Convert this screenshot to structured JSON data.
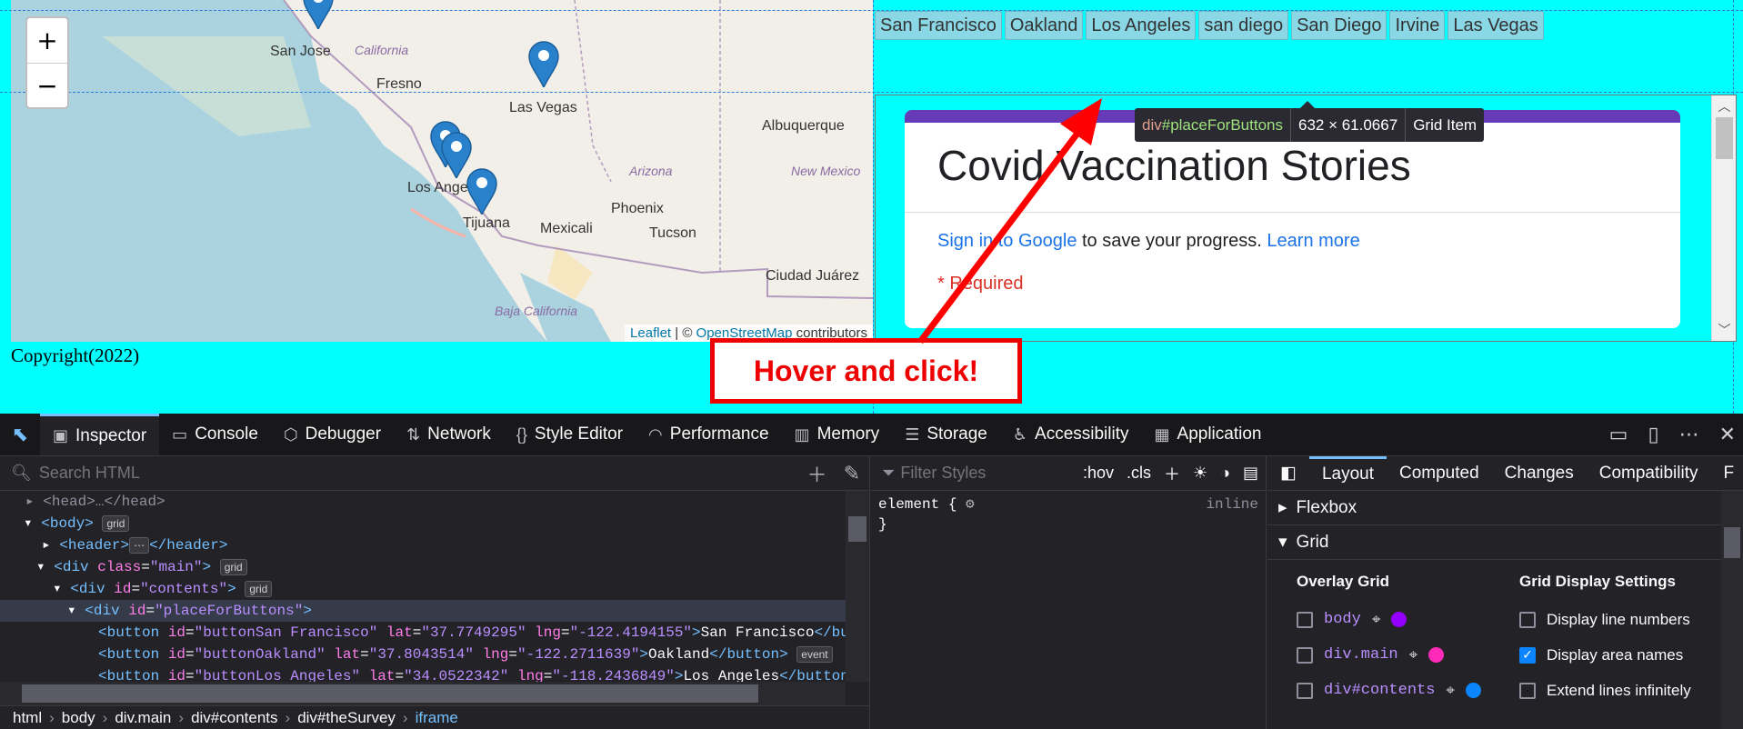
{
  "map": {
    "zoom_in": "+",
    "zoom_out": "−",
    "labels": {
      "san_jose": "San Jose",
      "california": "California",
      "fresno": "Fresno",
      "las_vegas": "Las Vegas",
      "albuquerque": "Albuquerque",
      "arizona": "Arizona",
      "new_mexico": "New Mexico",
      "los_angeles": "Los Ange",
      "phoenix": "Phoenix",
      "tijuana": "Tijuana",
      "mexicali": "Mexicali",
      "tucson": "Tucson",
      "ciudad_juarez": "Ciudad Juárez",
      "baja_california": "Baja California"
    },
    "attribution": {
      "leaflet": "Leaflet",
      "sep": " | © ",
      "osm": "OpenStreetMap",
      "contributors": " contributors"
    }
  },
  "footer": {
    "copyright": "Copyright(2022)"
  },
  "city_buttons": [
    "San Francisco",
    "Oakland",
    "Los Angeles",
    "san diego",
    "San Diego",
    "Irvine",
    "Las Vegas"
  ],
  "tooltip": {
    "tag": "div",
    "id": "#placeForButtons",
    "size": "632 × 61.0667",
    "type": "Grid Item"
  },
  "form": {
    "title": "Covid Vaccination Stories",
    "sign_in_link": "Sign in to Google",
    "sign_in_text": " to save your progress. ",
    "learn_more": "Learn more",
    "required": "* Required"
  },
  "callout": {
    "text": "Hover and click!"
  },
  "devtools": {
    "tabs": [
      "Inspector",
      "Console",
      "Debugger",
      "Network",
      "Style Editor",
      "Performance",
      "Memory",
      "Storage",
      "Accessibility",
      "Application"
    ],
    "search_placeholder": "Search HTML",
    "filter_placeholder": "Filter Styles",
    "hov": ":hov",
    "cls": ".cls",
    "element_rule": "element {",
    "element_close": "}",
    "inline": "inline",
    "tree": {
      "body": "body",
      "grid": "grid",
      "header": "header",
      "div_main_class": "main",
      "contents_id": "contents",
      "place_id": "placeForButtons",
      "event": "event",
      "btn1": {
        "id": "buttonSan Francisco",
        "lat": "37.7749295",
        "lng": "-122.4194155",
        "text": "San Francisco"
      },
      "btn2": {
        "id": "buttonOakland",
        "lat": "37.8043514",
        "lng": "-122.2711639",
        "text": "Oakland"
      },
      "btn3": {
        "id": "buttonLos Angeles",
        "lat": "34.0522342",
        "lng": "-118.2436849",
        "text": "Los Angeles"
      }
    },
    "breadcrumbs": [
      "html",
      "body",
      "div.main",
      "div#contents",
      "div#theSurvey",
      "iframe"
    ],
    "right_tabs": [
      "Layout",
      "Computed",
      "Changes",
      "Compatibility",
      "F"
    ],
    "sections": {
      "flexbox": "Flexbox",
      "grid": "Grid"
    },
    "overlay_title": "Overlay Grid",
    "overlay_items": [
      {
        "label": "body",
        "color": "#9400ff"
      },
      {
        "label": "div.main",
        "color": "#ff2ab7"
      },
      {
        "label": "div#contents",
        "color": "#0a84ff"
      }
    ],
    "display_title": "Grid Display Settings",
    "display_settings": [
      {
        "label": "Display line numbers",
        "checked": false
      },
      {
        "label": "Display area names",
        "checked": true
      },
      {
        "label": "Extend lines infinitely",
        "checked": false
      }
    ]
  }
}
